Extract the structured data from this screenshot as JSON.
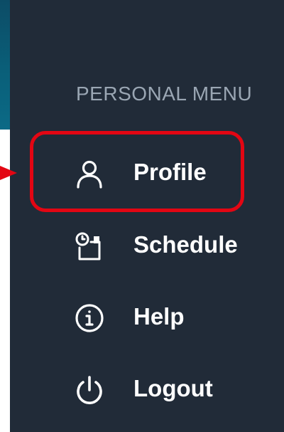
{
  "menu": {
    "heading": "PERSONAL MENU",
    "items": [
      {
        "label": "Profile",
        "icon": "user-icon"
      },
      {
        "label": "Schedule",
        "icon": "schedule-icon"
      },
      {
        "label": "Help",
        "icon": "info-icon"
      },
      {
        "label": "Logout",
        "icon": "power-icon"
      }
    ]
  },
  "colors": {
    "panel_bg": "#212b38",
    "heading_text": "#9aa6b3",
    "item_text": "#ffffff",
    "highlight": "#e30613",
    "left_accent": "#0b5f7a"
  }
}
